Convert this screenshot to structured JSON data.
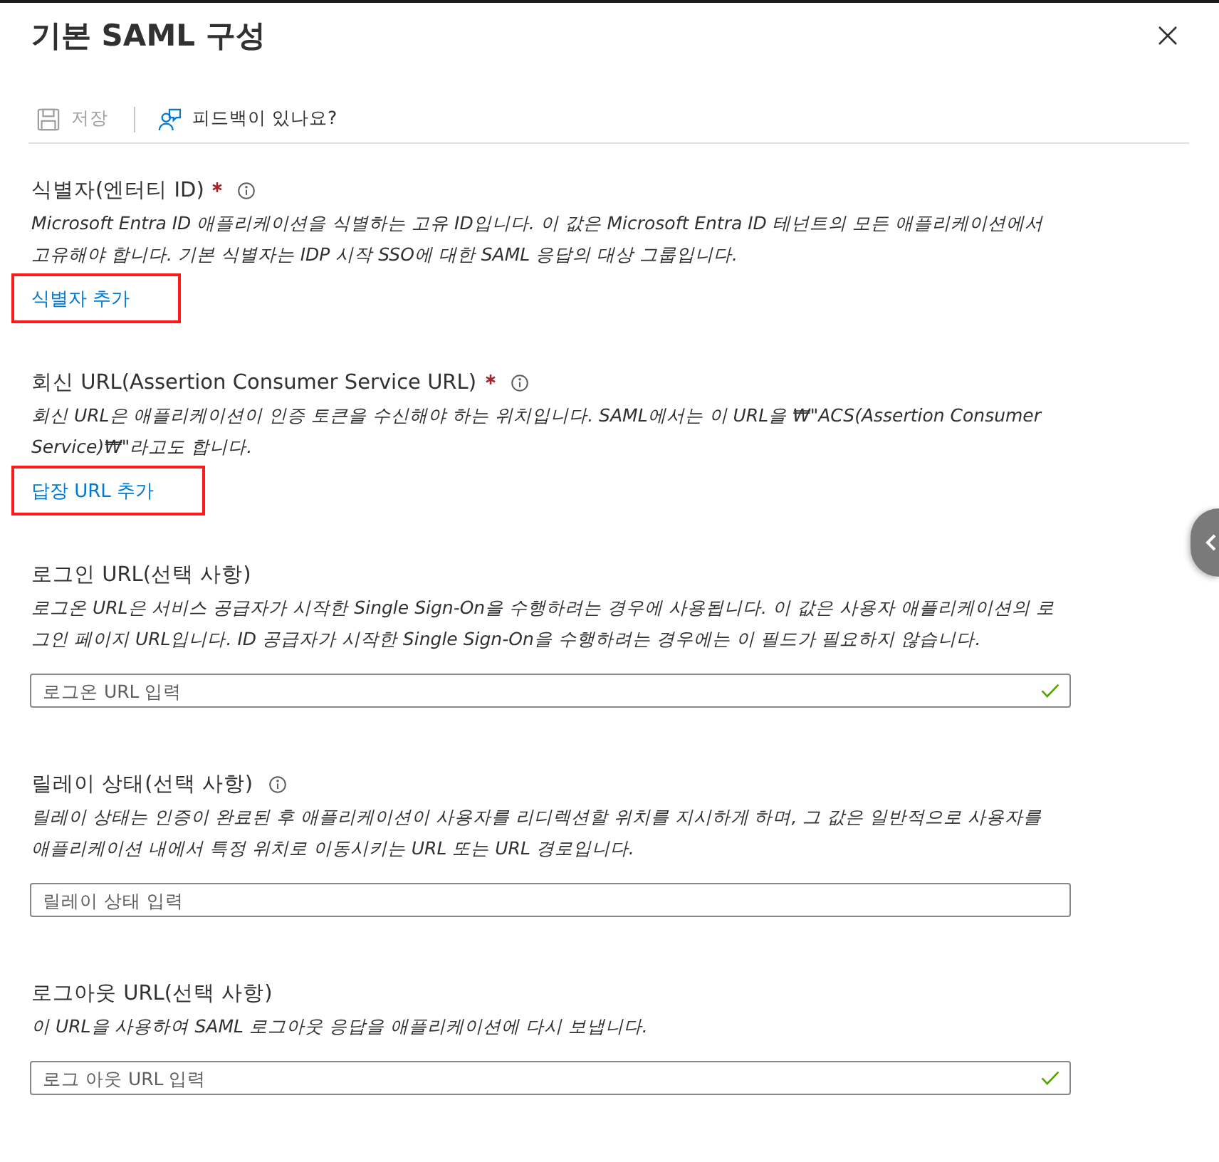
{
  "title": "기본 SAML 구성",
  "toolbar": [
    {
      "kind": "save",
      "label": "저장",
      "disabled": true
    },
    {
      "kind": "feedback",
      "label": "피드백이 있나요?",
      "disabled": false
    }
  ],
  "sections": [
    {
      "kind": "link",
      "heading": "식별자(엔터티 ID)",
      "required": true,
      "info": true,
      "description": "Microsoft Entra ID 애플리케이션을 식별하는 고유 ID입니다. 이 값은 Microsoft Entra ID 테넌트의 모든 애플리케이션에서 고유해야 합니다. 기본 식별자는 IDP 시작 SSO에 대한 SAML 응답의 대상 그룹입니다.",
      "link": {
        "label": "식별자 추가",
        "highlighted": true
      }
    },
    {
      "kind": "link",
      "heading": "회신 URL(Assertion Consumer Service URL)",
      "required": true,
      "info": true,
      "description": "회신 URL은 애플리케이션이 인증 토큰을 수신해야 하는 위치입니다. SAML에서는 이 URL을 ₩\"ACS(Assertion Consumer Service)₩\"라고도 합니다.",
      "link": {
        "label": "답장 URL 추가",
        "highlighted": true
      }
    },
    {
      "kind": "input",
      "heading": "로그인 URL(선택 사항)",
      "required": false,
      "info": false,
      "description": "로그온 URL은 서비스 공급자가 시작한 Single Sign-On을 수행하려는 경우에 사용됩니다. 이 값은 사용자 애플리케이션의 로그인 페이지 URL입니다. ID 공급자가 시작한 Single Sign-On을 수행하려는 경우에는 이 필드가 필요하지 않습니다.",
      "field": {
        "placeholder": "로그온 URL 입력",
        "valid": true
      }
    },
    {
      "kind": "input",
      "heading": "릴레이 상태(선택 사항)",
      "required": false,
      "info": true,
      "description": "릴레이 상태는 인증이 완료된 후 애플리케이션이 사용자를 리디렉션할 위치를 지시하게 하며, 그 값은 일반적으로 사용자를 애플리케이션 내에서 특정 위치로 이동시키는 URL 또는 URL 경로입니다.",
      "field": {
        "placeholder": "릴레이 상태 입력",
        "valid": false
      }
    },
    {
      "kind": "input",
      "heading": "로그아웃 URL(선택 사항)",
      "required": false,
      "info": false,
      "description": "이 URL을 사용하여 SAML 로그아웃 응답을 애플리케이션에 다시 보냅니다.",
      "field": {
        "placeholder": "로그 아웃 URL 입력",
        "valid": true
      }
    }
  ]
}
